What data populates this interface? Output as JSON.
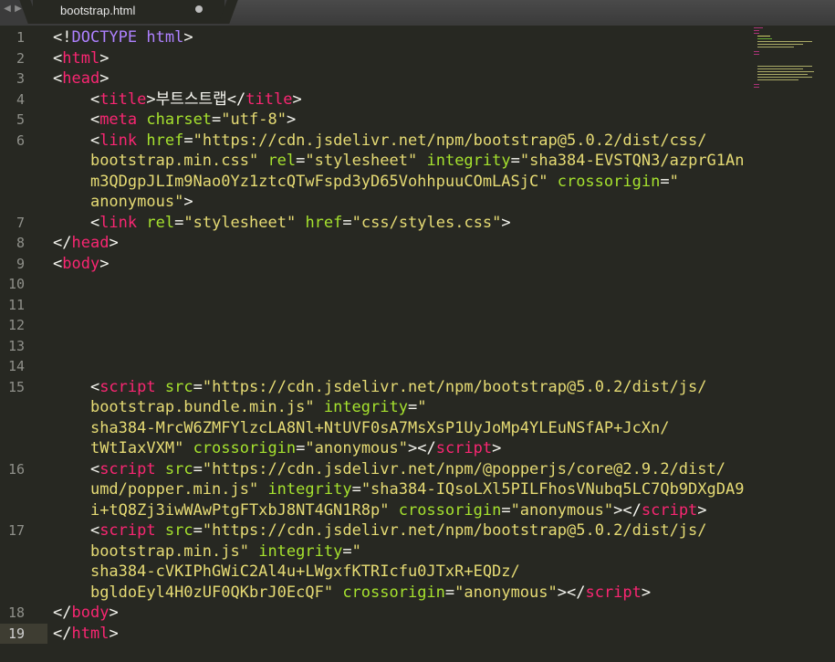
{
  "tab": {
    "filename": "bootstrap.html",
    "nav_left": "◀",
    "nav_right": "▶"
  },
  "line_numbers": [
    "1",
    "2",
    "3",
    "4",
    "5",
    "6",
    "7",
    "8",
    "9",
    "10",
    "11",
    "12",
    "13",
    "14",
    "15",
    "16",
    "17",
    "18",
    "19"
  ],
  "code": {
    "l1": [
      "<!",
      "DOCTYPE",
      " ",
      "html",
      ">"
    ],
    "l2": [
      "<",
      "html",
      ">"
    ],
    "l3": [
      "<",
      "head",
      ">"
    ],
    "l4": [
      "    <",
      "title",
      ">부트스트랩</",
      "title",
      ">"
    ],
    "l5": [
      "    <",
      "meta",
      " ",
      "charset",
      "=",
      "\"utf-8\"",
      ">"
    ],
    "l6a": [
      "    <",
      "link",
      " ",
      "href",
      "=",
      "\"https://cdn.jsdelivr.net/npm/bootstrap@5.0.2/dist/css/"
    ],
    "l6b": [
      "    ",
      "bootstrap.min.css\"",
      " ",
      "rel",
      "=",
      "\"stylesheet\"",
      " ",
      "integrity",
      "=",
      "\"sha384-EVSTQN3/azprG1An"
    ],
    "l6c": [
      "    ",
      "m3QDgpJLIm9Nao0Yz1ztcQTwFspd3yD65VohhpuuCOmLASjC\"",
      " ",
      "crossorigin",
      "=",
      "\""
    ],
    "l6d": [
      "    ",
      "anonymous\"",
      ">"
    ],
    "l7": [
      "    <",
      "link",
      " ",
      "rel",
      "=",
      "\"stylesheet\"",
      " ",
      "href",
      "=",
      "\"css/styles.css\"",
      ">"
    ],
    "l8": [
      "</",
      "head",
      ">"
    ],
    "l9": [
      "<",
      "body",
      ">"
    ],
    "l15a": [
      "    <",
      "script",
      " ",
      "src",
      "=",
      "\"https://cdn.jsdelivr.net/npm/bootstrap@5.0.2/dist/js/"
    ],
    "l15b": [
      "    ",
      "bootstrap.bundle.min.js\"",
      " ",
      "integrity",
      "=",
      "\""
    ],
    "l15c": [
      "    ",
      "sha384-MrcW6ZMFYlzcLA8Nl+NtUVF0sA7MsXsP1UyJoMp4YLEuNSfAP+JcXn/"
    ],
    "l15d": [
      "    ",
      "tWtIaxVXM\"",
      " ",
      "crossorigin",
      "=",
      "\"anonymous\"",
      "></",
      "script",
      ">"
    ],
    "l16a": [
      "    <",
      "script",
      " ",
      "src",
      "=",
      "\"https://cdn.jsdelivr.net/npm/@popperjs/core@2.9.2/dist/"
    ],
    "l16b": [
      "    ",
      "umd/popper.min.js\"",
      " ",
      "integrity",
      "=",
      "\"sha384-IQsoLXl5PILFhosVNubq5LC7Qb9DXgDA9"
    ],
    "l16c": [
      "    ",
      "i+tQ8Zj3iwWAwPtgFTxbJ8NT4GN1R8p\"",
      " ",
      "crossorigin",
      "=",
      "\"anonymous\"",
      "></",
      "script",
      ">"
    ],
    "l17a": [
      "    <",
      "script",
      " ",
      "src",
      "=",
      "\"https://cdn.jsdelivr.net/npm/bootstrap@5.0.2/dist/js/"
    ],
    "l17b": [
      "    ",
      "bootstrap.min.js\"",
      " ",
      "integrity",
      "=",
      "\""
    ],
    "l17c": [
      "    ",
      "sha384-cVKIPhGWiC2Al4u+LWgxfKTRIcfu0JTxR+EQDz/"
    ],
    "l17d": [
      "    ",
      "bgldoEyl4H0zUF0QKbrJ0EcQF\"",
      " ",
      "crossorigin",
      "=",
      "\"anonymous\"",
      "></",
      "script",
      ">"
    ],
    "l18": [
      "</",
      "body",
      ">"
    ],
    "l19": [
      "</",
      "html",
      ">"
    ]
  },
  "colors": {
    "background": "#272822",
    "tag": "#f92672",
    "attribute": "#a6e22e",
    "string": "#e6db74",
    "doctype": "#ae81ff",
    "text": "#f8f8f2",
    "line_number": "#8f908a"
  }
}
